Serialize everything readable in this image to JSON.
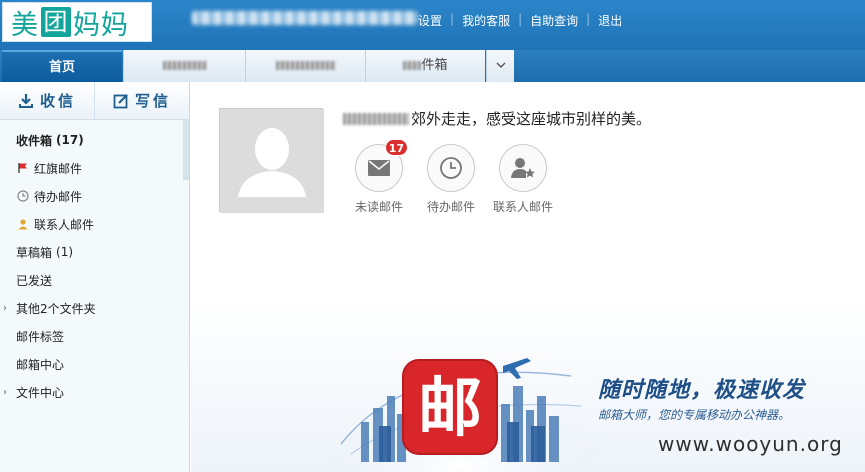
{
  "header": {
    "logo_text": "美团妈妈",
    "links": [
      "设置",
      "我的客服",
      "自助查询",
      "退出"
    ]
  },
  "tabs": {
    "home": "首页",
    "inbox_suffix": "件箱"
  },
  "sidebar": {
    "receive": "收信",
    "compose": "写信",
    "folders": [
      {
        "label": "收件箱",
        "count": "(17)",
        "bold": true
      },
      {
        "label": "红旗邮件",
        "icon": "red-flag-icon"
      },
      {
        "label": "待办邮件",
        "icon": "clock-icon"
      },
      {
        "label": "联系人邮件",
        "icon": "contact-icon"
      },
      {
        "label": "草稿箱",
        "count": "(1)"
      },
      {
        "label": "已发送"
      },
      {
        "label": "其他2个文件夹",
        "expandable": true
      },
      {
        "label": "邮件标签"
      },
      {
        "label": "邮箱中心"
      },
      {
        "label": "文件中心",
        "expandable": true
      }
    ]
  },
  "main": {
    "greeting": "郊外走走，感受这座城市别样的美。",
    "shortcuts": [
      {
        "label": "未读邮件",
        "badge": "17",
        "icon": "envelope-icon"
      },
      {
        "label": "待办邮件",
        "icon": "clock-icon"
      },
      {
        "label": "联系人邮件",
        "icon": "contact-star-icon"
      }
    ],
    "promo": {
      "logo_char": "邮",
      "slogan": "随时随地，极速收发",
      "sub": "邮箱大师，您的专属移动办公神器。"
    },
    "watermark": "www.wooyun.org"
  },
  "colors": {
    "header": "#1f73b6",
    "accent": "#1e4f86",
    "badge": "#d9302f",
    "logo": "#13a59b"
  }
}
